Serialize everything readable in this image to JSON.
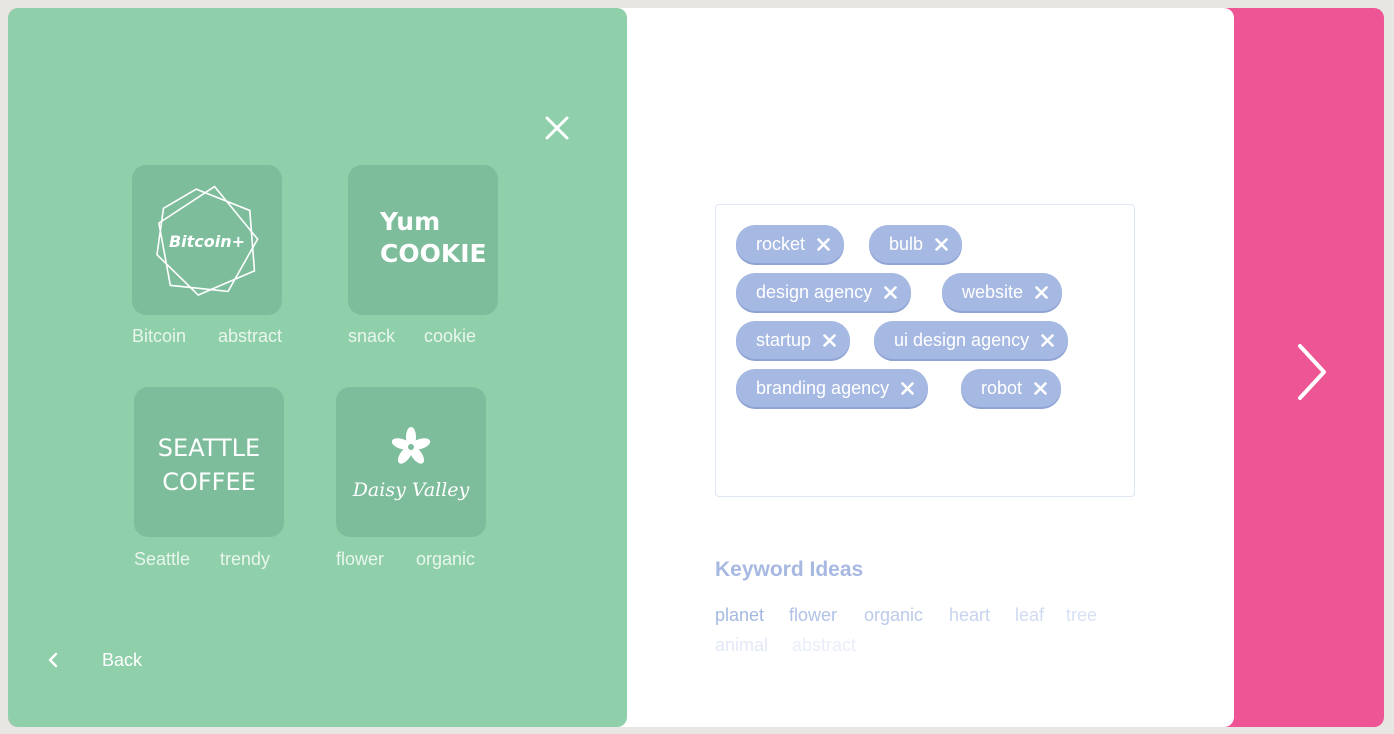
{
  "close_icon": "close-icon",
  "logos": [
    {
      "name": "Bitcoin+",
      "tags": [
        "Bitcoin",
        "abstract"
      ]
    },
    {
      "name_line1": "Yum",
      "name_line2": "COOKIE",
      "tags": [
        "snack",
        "cookie"
      ]
    },
    {
      "name_line1": "SEATTLE",
      "name_line2": "COFFEE",
      "tags": [
        "Seattle",
        "trendy"
      ]
    },
    {
      "name": "Daisy Valley",
      "tags": [
        "flower",
        "organic"
      ]
    }
  ],
  "back_label": "Back",
  "selected_keywords": [
    "rocket",
    "bulb",
    "design agency",
    "website",
    "startup",
    "ui design agency",
    "branding agency",
    "robot"
  ],
  "keyword_ideas_title": "Keyword Ideas",
  "keyword_ideas": [
    "planet",
    "flower",
    "organic",
    "heart",
    "leaf",
    "tree",
    "animal",
    "abstract"
  ],
  "colors": {
    "green_panel": "#8fcfa9",
    "card": "#7dbd9c",
    "chip": "#a6b9e2",
    "accent_pink": "#ee5594"
  }
}
